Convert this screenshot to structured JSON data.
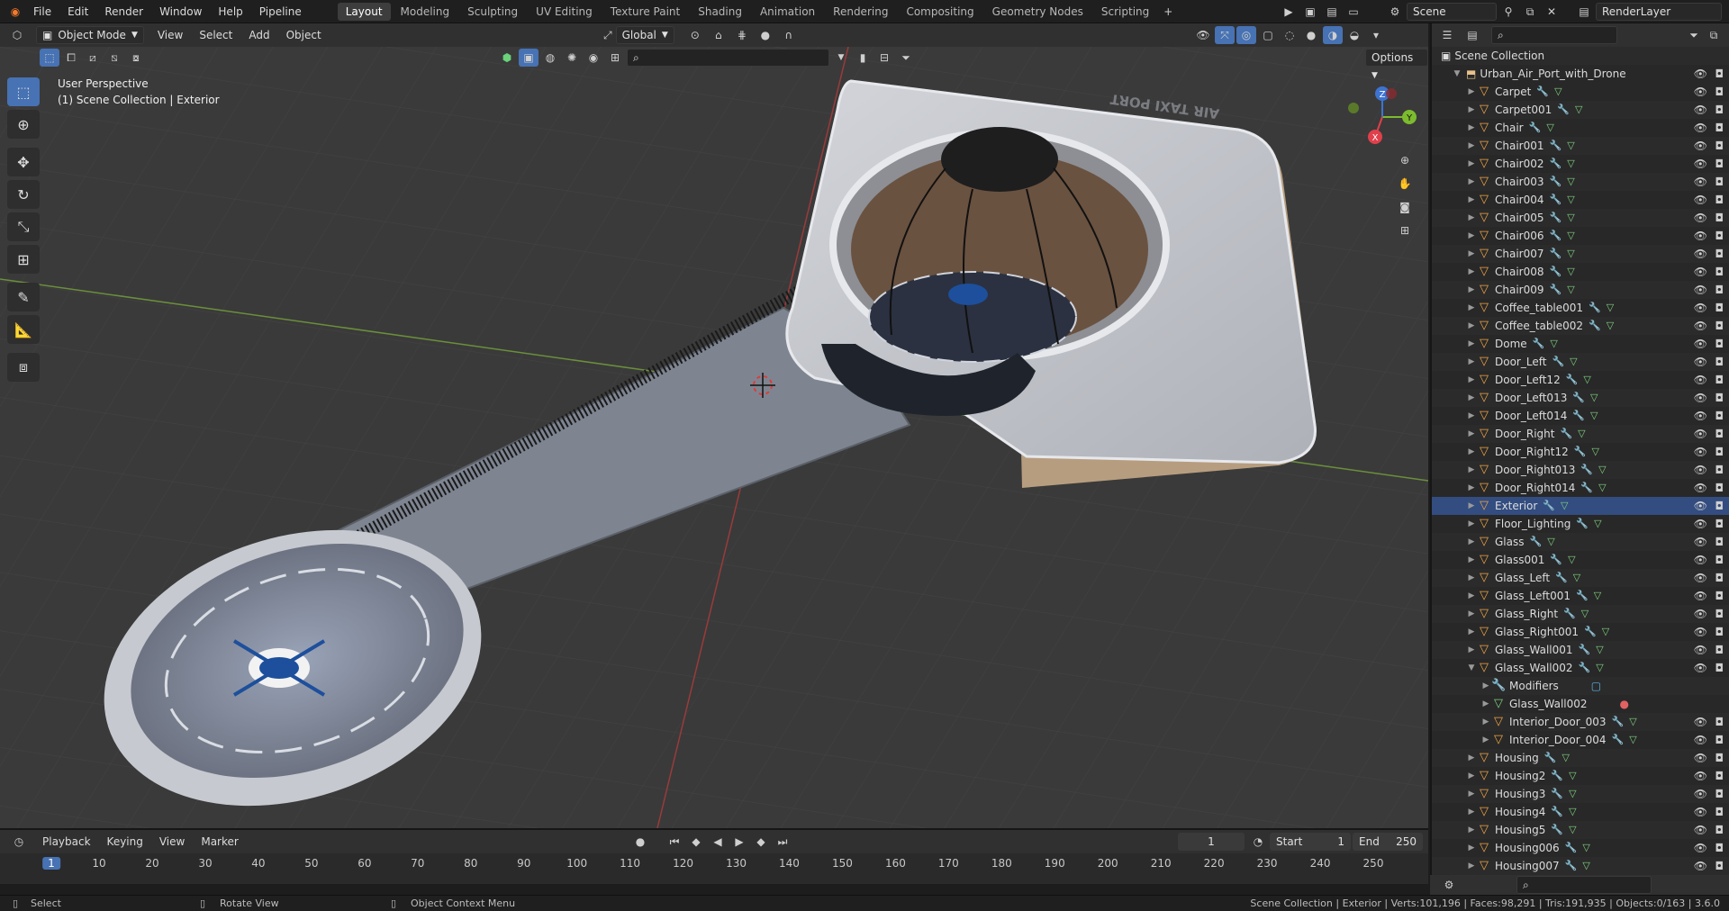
{
  "topbar": {
    "menus": [
      "File",
      "Edit",
      "Render",
      "Window",
      "Help",
      "Pipeline"
    ],
    "workspaces": [
      "Layout",
      "Modeling",
      "Sculpting",
      "UV Editing",
      "Texture Paint",
      "Shading",
      "Animation",
      "Rendering",
      "Compositing",
      "Geometry Nodes",
      "Scripting"
    ],
    "active_workspace": "Layout",
    "scene_name": "Scene",
    "view_layer": "RenderLayer"
  },
  "viewport_header": {
    "mode": "Object Mode",
    "menus": [
      "View",
      "Select",
      "Add",
      "Object"
    ],
    "orientation": "Global",
    "options_label": "Options"
  },
  "viewport": {
    "perspective_label": "User Perspective",
    "collection_label": "(1) Scene Collection | Exterior",
    "sign_text": "AIR TAXI PORT",
    "gizmo": {
      "x": "X",
      "y": "Y",
      "z": "Z"
    }
  },
  "tools": [
    "select-box",
    "cursor",
    "move",
    "rotate",
    "scale",
    "transform",
    "annotate",
    "measure",
    "add-cube"
  ],
  "outliner": {
    "root": "Scene Collection",
    "collection": "Urban_Air_Port_with_Drone",
    "items": [
      {
        "name": "Carpet",
        "expanded": false
      },
      {
        "name": "Carpet001",
        "expanded": false
      },
      {
        "name": "Chair",
        "expanded": false
      },
      {
        "name": "Chair001",
        "expanded": false
      },
      {
        "name": "Chair002",
        "expanded": false
      },
      {
        "name": "Chair003",
        "expanded": false
      },
      {
        "name": "Chair004",
        "expanded": false
      },
      {
        "name": "Chair005",
        "expanded": false
      },
      {
        "name": "Chair006",
        "expanded": false
      },
      {
        "name": "Chair007",
        "expanded": false
      },
      {
        "name": "Chair008",
        "expanded": false
      },
      {
        "name": "Chair009",
        "expanded": false
      },
      {
        "name": "Coffee_table001",
        "expanded": false
      },
      {
        "name": "Coffee_table002",
        "expanded": false
      },
      {
        "name": "Dome",
        "expanded": false
      },
      {
        "name": "Door_Left",
        "expanded": false
      },
      {
        "name": "Door_Left12",
        "expanded": false
      },
      {
        "name": "Door_Left013",
        "expanded": false
      },
      {
        "name": "Door_Left014",
        "expanded": false
      },
      {
        "name": "Door_Right",
        "expanded": false
      },
      {
        "name": "Door_Right12",
        "expanded": false
      },
      {
        "name": "Door_Right013",
        "expanded": false
      },
      {
        "name": "Door_Right014",
        "expanded": false
      },
      {
        "name": "Exterior",
        "expanded": false,
        "active": true
      },
      {
        "name": "Floor_Lighting",
        "expanded": false
      },
      {
        "name": "Glass",
        "expanded": false
      },
      {
        "name": "Glass001",
        "expanded": false
      },
      {
        "name": "Glass_Left",
        "expanded": false
      },
      {
        "name": "Glass_Left001",
        "expanded": false
      },
      {
        "name": "Glass_Right",
        "expanded": false
      },
      {
        "name": "Glass_Right001",
        "expanded": false
      },
      {
        "name": "Glass_Wall001",
        "expanded": false
      },
      {
        "name": "Glass_Wall002",
        "expanded": true
      },
      {
        "name": "Modifiers",
        "child": true,
        "kind": "modifiers"
      },
      {
        "name": "Glass_Wall002",
        "child": true,
        "kind": "mesh"
      },
      {
        "name": "Interior_Door_003",
        "child": true,
        "kind": "object"
      },
      {
        "name": "Interior_Door_004",
        "child": true,
        "kind": "object"
      },
      {
        "name": "Housing",
        "expanded": false
      },
      {
        "name": "Housing2",
        "expanded": false
      },
      {
        "name": "Housing3",
        "expanded": false
      },
      {
        "name": "Housing4",
        "expanded": false
      },
      {
        "name": "Housing5",
        "expanded": false
      },
      {
        "name": "Housing006",
        "expanded": false
      },
      {
        "name": "Housing007",
        "expanded": false
      }
    ]
  },
  "timeline": {
    "menus": [
      "Playback",
      "Keying",
      "View",
      "Marker"
    ],
    "current_frame": "1",
    "start_label": "Start",
    "start": "1",
    "end_label": "End",
    "end": "250",
    "ticks": [
      1,
      10,
      20,
      30,
      40,
      50,
      60,
      70,
      80,
      90,
      100,
      110,
      120,
      130,
      140,
      150,
      160,
      170,
      180,
      190,
      200,
      210,
      220,
      230,
      240,
      250
    ]
  },
  "statusbar": {
    "select": "Select",
    "rotate": "Rotate View",
    "context": "Object Context Menu",
    "stats": "Scene Collection | Exterior | Verts:101,196 | Faces:98,291 | Tris:191,935 | Objects:0/163 | 3.6.0"
  }
}
